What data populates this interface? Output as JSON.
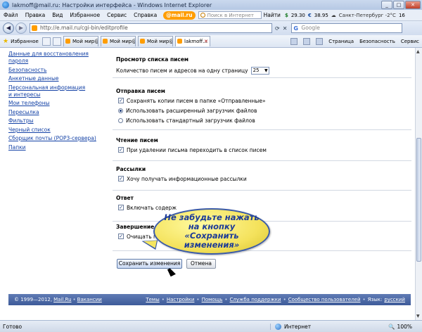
{
  "window": {
    "title": "lakmoff@mail.ru: Настройки интерфейса - Windows Internet Explorer"
  },
  "menu": {
    "items": [
      "Файл",
      "Правка",
      "Вид",
      "Избранное",
      "Сервис",
      "Справка"
    ],
    "mail_logo": "@mail.ru",
    "search_placeholder": "Поиск в Интернет",
    "find_label": "Найти",
    "dollar": "29.30",
    "euro": "38.95",
    "weather": "Санкт-Петербург -2°C",
    "extra": "16"
  },
  "address": {
    "url": "http://e.mail.ru/cgi-bin/editprofile",
    "google_placeholder": "Google"
  },
  "tabs": {
    "favorites_label": "Избранное",
    "items": [
      {
        "label": "Мой мир@M..."
      },
      {
        "label": "Мой мир@M..."
      },
      {
        "label": "Мой мир@M..."
      },
      {
        "label": "lakmoff..."
      }
    ],
    "page_menu": "Страница",
    "security_menu": "Безопасность",
    "service_menu": "Сервис"
  },
  "sidebar": {
    "links": [
      "Данные для восстановления пароля",
      "Безопасность",
      "Анкетные данные",
      "Персональная информация",
      "и интересы",
      "Мои телефоны",
      "Пересылка",
      "Фильтры",
      "Черный список",
      "Сборщик почты (POP3-сервера)",
      "Папки"
    ]
  },
  "settings": {
    "list_view": {
      "title": "Просмотр списка писем",
      "count_label": "Количество писем и адресов на одну страницу",
      "count_value": "25"
    },
    "sending": {
      "title": "Отправка писем",
      "save_copies": "Сохранять копии писем в папке «Отправленные»",
      "advanced_uploader": "Использовать расширенный загрузчик файлов",
      "standard_uploader": "Использовать стандартный загрузчик файлов"
    },
    "reading": {
      "title": "Чтение писем",
      "go_to_list": "При удалении письма переходить в список писем"
    },
    "mailings": {
      "title": "Рассылки",
      "receive": "Хочу получать информационные рассылки"
    },
    "reply": {
      "title": "Ответ",
      "include": "Включать содерж"
    },
    "finish": {
      "title": "Завершение р",
      "clear": "Очищать папку"
    },
    "save_button": "Сохранить изменения",
    "cancel_button": "Отмена"
  },
  "callout": {
    "text": "Не забудьте нажать на кнопку «Сохранить изменения»"
  },
  "footer": {
    "copyright": "© 1999—2012,",
    "mailru": "Mail.Ru",
    "vacancies": "Вакансии",
    "themes": "Темы",
    "settings": "Настройки",
    "help": "Помощь",
    "support": "Служба поддержки",
    "community": "Сообщество пользователей",
    "lang_label": "Язык:",
    "lang": "русский"
  },
  "status": {
    "text": "Готово",
    "zone": "Интернет",
    "zoom": "100%"
  }
}
